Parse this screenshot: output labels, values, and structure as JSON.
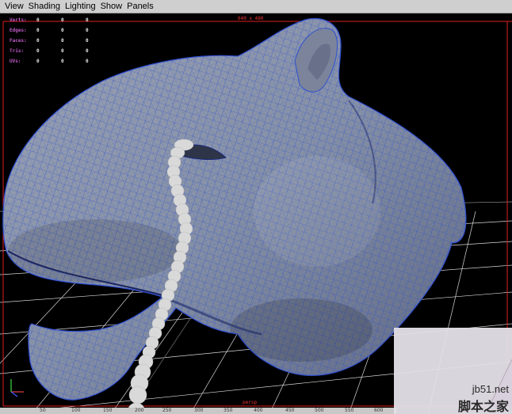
{
  "menu": {
    "items": [
      "View",
      "Shading",
      "Lighting",
      "Show",
      "Panels"
    ]
  },
  "hud": {
    "rows": [
      {
        "label": "Verts:",
        "values": [
          "0",
          "0",
          "0"
        ]
      },
      {
        "label": "Edges:",
        "values": [
          "0",
          "0",
          "0"
        ]
      },
      {
        "label": "Faces:",
        "values": [
          "0",
          "0",
          "0"
        ]
      },
      {
        "label": "Tris:",
        "values": [
          "0",
          "0",
          "0"
        ]
      },
      {
        "label": "UVs:",
        "values": [
          "0",
          "0",
          "0"
        ]
      }
    ]
  },
  "viewport": {
    "resolution_gate": "640 x 480",
    "camera_name": "persp"
  },
  "ruler": {
    "ticks": [
      "50",
      "100",
      "150",
      "200",
      "250",
      "300",
      "350",
      "400",
      "450",
      "500",
      "550",
      "600"
    ]
  },
  "watermark": {
    "url": "jb51.net",
    "site_name": "脚本之家"
  },
  "colors": {
    "gate_line": "#e02020",
    "hud_label": "#c05bc8",
    "wire": "#2f4fd0",
    "mesh_fill": "#8a93a6",
    "grid": "#d8d8d8"
  }
}
